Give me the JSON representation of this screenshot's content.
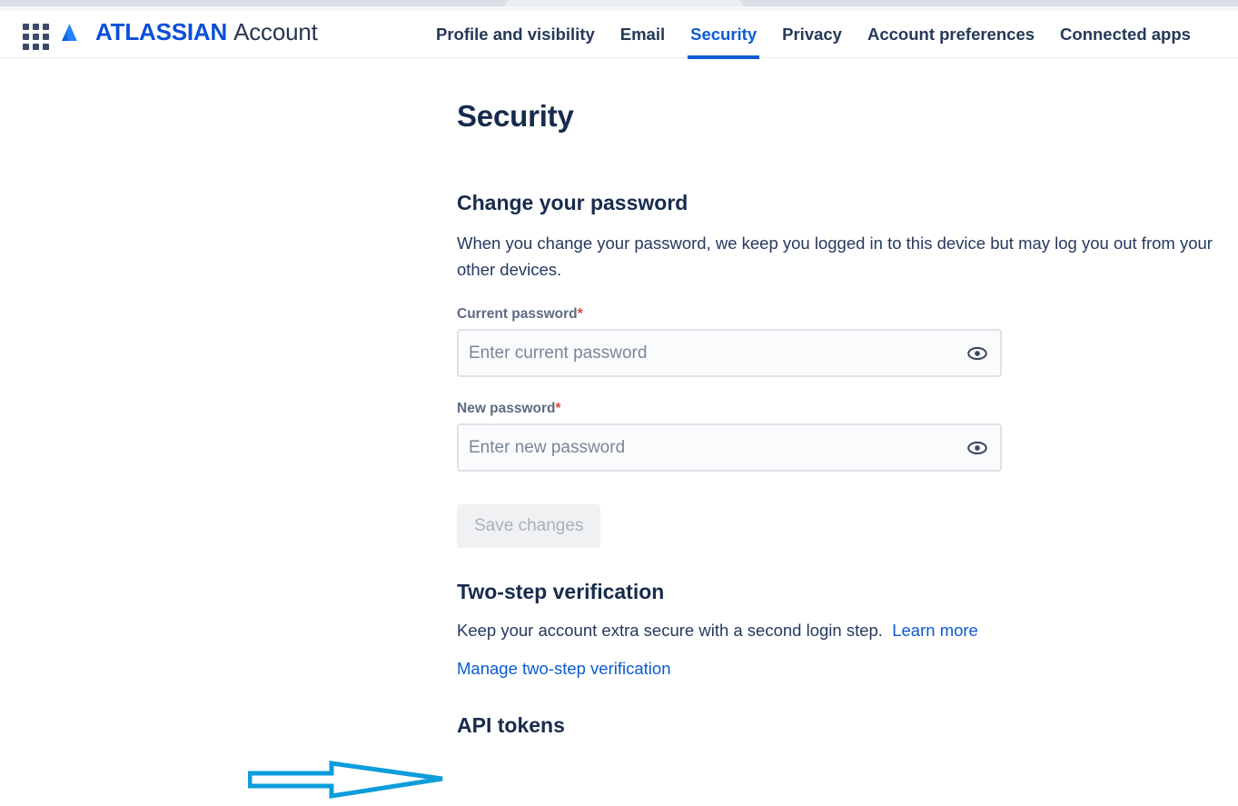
{
  "browser": {
    "tab_strip_visible": true
  },
  "header": {
    "app_switcher_icon": "grid-apps-icon",
    "logo_icon": "atlassian-logo-icon",
    "brand_bold": "ATLASSIAN",
    "brand_light": "Account",
    "tabs": [
      {
        "label": "Profile and visibility",
        "active": false
      },
      {
        "label": "Email",
        "active": false
      },
      {
        "label": "Security",
        "active": true
      },
      {
        "label": "Privacy",
        "active": false
      },
      {
        "label": "Account preferences",
        "active": false
      },
      {
        "label": "Connected apps",
        "active": false
      }
    ]
  },
  "main": {
    "page_title": "Security",
    "password_section": {
      "heading": "Change your password",
      "description": "When you change your password, we keep you logged in to this device but may log you out from your other devices.",
      "current_password": {
        "label": "Current password",
        "required_marker": "*",
        "placeholder": "Enter current password",
        "value": "",
        "reveal_icon": "eye-icon"
      },
      "new_password": {
        "label": "New password",
        "required_marker": "*",
        "placeholder": "Enter new password",
        "value": "",
        "reveal_icon": "eye-icon"
      },
      "save_button": {
        "label": "Save changes",
        "disabled": true
      }
    },
    "two_step_section": {
      "heading": "Two-step verification",
      "description": "Keep your account extra secure with a second login step.",
      "learn_more_label": "Learn more",
      "manage_link_label": "Manage two-step verification"
    },
    "api_tokens_section": {
      "heading": "API tokens"
    }
  },
  "annotation": {
    "arrow_icon": "arrow-right-annotation",
    "color": "#0d9ddb",
    "points_to": "API tokens"
  },
  "colors": {
    "brand_blue": "#0b4fd6",
    "link_blue": "#0b5bd3",
    "heading_navy": "#172b4d",
    "body_navy": "#25395e",
    "label_gray": "#5d6b82",
    "field_bg": "#fafbfc",
    "field_border": "#dfe1e6",
    "disabled_btn_bg": "#f0f1f3",
    "disabled_btn_text": "#a9b0bd",
    "required_red": "#d94c32",
    "annotation_cyan": "#0d9ddb"
  }
}
